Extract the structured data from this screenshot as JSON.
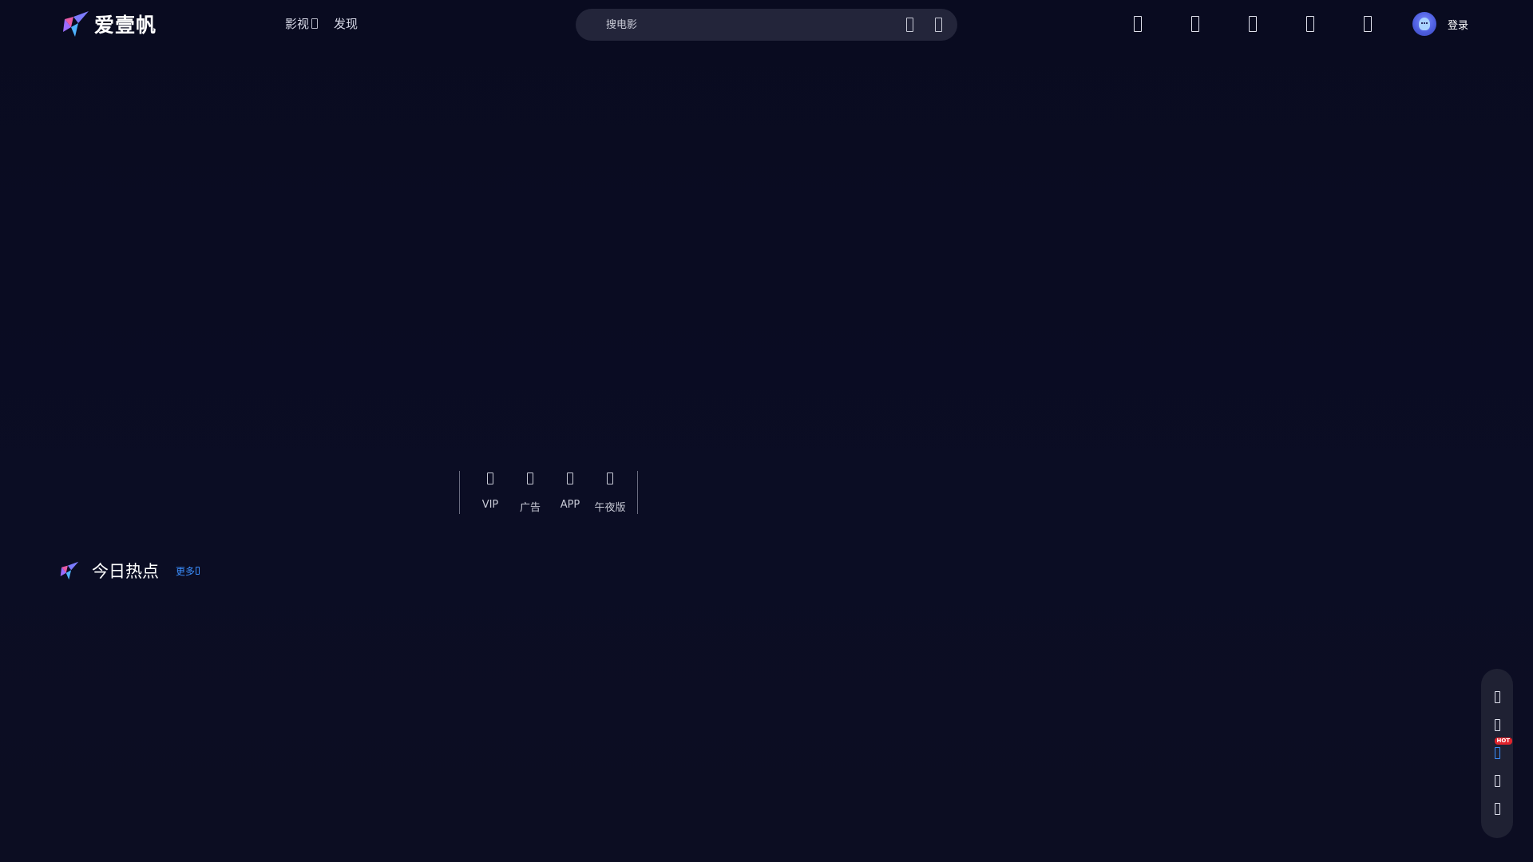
{
  "header": {
    "logo_text": "爱壹帆",
    "nav": [
      {
        "label": "影视",
        "has_dropdown": true
      },
      {
        "label": "发现",
        "has_dropdown": false
      }
    ],
    "search": {
      "placeholder": "搜电影",
      "value": ""
    },
    "top_icons": [
      "history-icon",
      "download-icon",
      "app-icon",
      "message-icon",
      "vip-icon"
    ],
    "login_label": "登录"
  },
  "shortcuts": [
    {
      "label": "VIP",
      "icon": "vip-icon"
    },
    {
      "label": "广告",
      "icon": "ad-icon"
    },
    {
      "label": "APP",
      "icon": "app-icon"
    },
    {
      "label": "午夜版",
      "icon": "night-icon"
    }
  ],
  "section": {
    "title": "今日热点",
    "more_label": "更多"
  },
  "sidebar": {
    "badge": "HOT"
  },
  "colors": {
    "background": "#0b0d22",
    "search_bg": "#23253a",
    "accent_blue": "#3b8fff",
    "hot_red": "#e0242c"
  }
}
